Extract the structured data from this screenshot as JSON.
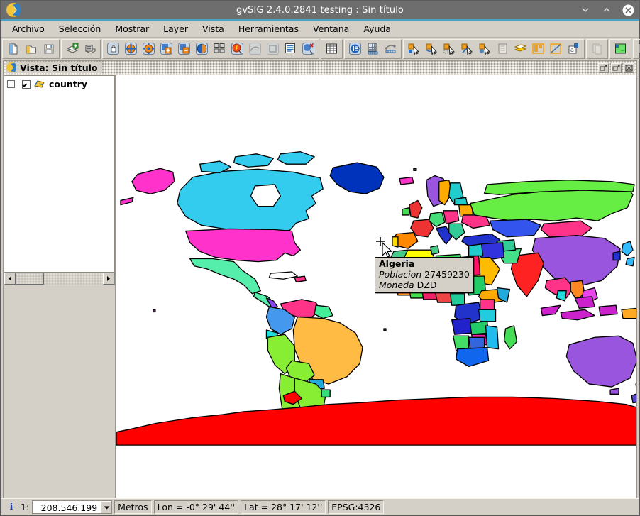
{
  "window": {
    "title": "gvSIG 2.4.0.2841 testing : Sin título",
    "logo_icon": "gvsig-logo-icon",
    "controls": [
      {
        "name": "minimize-button",
        "icon": "chevron-down-icon"
      },
      {
        "name": "maximize-button",
        "icon": "chevron-up-icon"
      },
      {
        "name": "close-button",
        "icon": "close-circle-icon"
      }
    ]
  },
  "menubar": {
    "items": [
      {
        "label": "Archivo",
        "mnemonic": "A"
      },
      {
        "label": "Selección",
        "mnemonic": "S"
      },
      {
        "label": "Mostrar",
        "mnemonic": "M"
      },
      {
        "label": "Layer",
        "mnemonic": "L"
      },
      {
        "label": "Vista",
        "mnemonic": "V"
      },
      {
        "label": "Herramientas",
        "mnemonic": "H"
      },
      {
        "label": "Ventana",
        "mnemonic": "V"
      },
      {
        "label": "Ayuda",
        "mnemonic": "A"
      }
    ]
  },
  "toolbar": {
    "groups": [
      {
        "name": "file-group",
        "buttons": [
          {
            "name": "new-project-button",
            "icon": "new-document-icon",
            "state": "enabled"
          },
          {
            "name": "open-project-button",
            "icon": "open-folder-icon",
            "state": "enabled"
          },
          {
            "name": "save-project-button",
            "icon": "save-disk-icon",
            "state": "enabled"
          }
        ]
      },
      {
        "name": "layer-group",
        "buttons": [
          {
            "name": "add-layer-button",
            "icon": "add-layer-icon",
            "state": "enabled"
          },
          {
            "name": "layer-properties-button",
            "icon": "layer-table-icon",
            "state": "enabled"
          }
        ]
      },
      {
        "name": "navigation-group",
        "buttons": [
          {
            "name": "pan-button",
            "icon": "hand-pan-icon",
            "state": "enabled"
          },
          {
            "name": "zoom-in-rect-button",
            "icon": "zoom-in-rect-icon",
            "state": "enabled"
          },
          {
            "name": "zoom-out-rect-button",
            "icon": "zoom-out-rect-icon",
            "state": "enabled"
          },
          {
            "name": "zoom-in-button",
            "icon": "zoom-plus-icon",
            "state": "enabled"
          },
          {
            "name": "zoom-out-button",
            "icon": "zoom-minus-icon",
            "state": "enabled"
          },
          {
            "name": "zoom-full-extent-button",
            "icon": "globe-extent-icon",
            "state": "enabled"
          },
          {
            "name": "zoom-to-layer-button",
            "icon": "zoom-layer-icon",
            "state": "enabled"
          },
          {
            "name": "info-tool-button",
            "icon": "info-arrow-icon",
            "state": "enabled"
          },
          {
            "name": "measure-distance-button",
            "icon": "measure-line-icon",
            "state": "disabled"
          },
          {
            "name": "measure-area-button",
            "icon": "measure-area-icon",
            "state": "disabled"
          },
          {
            "name": "view-center-button",
            "icon": "center-view-icon",
            "state": "enabled"
          },
          {
            "name": "zoom-previous-button",
            "icon": "zoom-prev-icon",
            "state": "enabled"
          }
        ]
      },
      {
        "name": "table-group",
        "buttons": [
          {
            "name": "attribute-table-button",
            "icon": "table-grid-icon",
            "state": "enabled"
          }
        ]
      },
      {
        "name": "annotation-group",
        "buttons": [
          {
            "name": "layer-info-button",
            "icon": "layer-info-icon",
            "state": "enabled"
          },
          {
            "name": "grid-settings-button",
            "icon": "grid-ruler-icon",
            "state": "enabled"
          },
          {
            "name": "profile-tool-button",
            "icon": "profile-curve-icon",
            "state": "enabled"
          }
        ]
      },
      {
        "name": "selection-group",
        "buttons": [
          {
            "name": "select-by-point-button",
            "icon": "select-point-icon",
            "state": "enabled"
          },
          {
            "name": "select-by-rect-button",
            "icon": "select-rect-icon",
            "state": "enabled"
          },
          {
            "name": "select-by-polygon-button",
            "icon": "select-polygon-icon",
            "state": "enabled"
          },
          {
            "name": "select-by-circle-button",
            "icon": "select-circle-icon",
            "state": "enabled"
          },
          {
            "name": "select-by-buffer-button",
            "icon": "select-buffer-icon",
            "state": "enabled"
          },
          {
            "name": "select-all-button",
            "icon": "select-all-icon",
            "state": "enabled"
          },
          {
            "name": "invert-selection-button",
            "icon": "invert-selection-icon",
            "state": "enabled"
          },
          {
            "name": "clear-selection-button",
            "icon": "clear-selection-icon",
            "state": "enabled"
          },
          {
            "name": "selection-by-layer-button",
            "icon": "selection-layer-icon",
            "state": "enabled"
          },
          {
            "name": "selection-by-attribute-button",
            "icon": "selection-attribute-icon",
            "state": "enabled"
          }
        ]
      },
      {
        "name": "geoprocess-group",
        "buttons": [
          {
            "name": "copy-features-button",
            "icon": "copy-features-icon",
            "state": "disabled"
          }
        ]
      },
      {
        "name": "raster-group",
        "buttons": [
          {
            "name": "raster-properties-button",
            "icon": "raster-image-icon",
            "state": "enabled"
          }
        ]
      },
      {
        "name": "catalog-group",
        "buttons": [
          {
            "name": "legend-editor-button",
            "icon": "legend-edit-icon",
            "state": "enabled"
          },
          {
            "name": "geoprocessing-button",
            "icon": "gear-star-icon",
            "state": "enabled"
          },
          {
            "name": "information-tool-button",
            "icon": "info-pencil-icon",
            "state": "selected"
          }
        ]
      }
    ]
  },
  "view_window": {
    "title": "Vista: Sin título",
    "icon": "gvsig-mini-logo-icon",
    "controls": [
      {
        "name": "restore-window-button",
        "icon": "restore-icon"
      },
      {
        "name": "maximize-window-button",
        "icon": "maximize-icon"
      },
      {
        "name": "close-window-button",
        "icon": "close-x-icon"
      }
    ]
  },
  "toc": {
    "layers": [
      {
        "name": "country",
        "visible": true,
        "expanded": false,
        "icon": "polygon-layer-icon"
      }
    ],
    "scrollbar": {
      "left_arrow": "◀",
      "right_arrow": "▶"
    }
  },
  "tooltip": {
    "title": "Algeria",
    "fields": [
      {
        "label": "Poblacion",
        "value": "27459230"
      },
      {
        "label": "Moneda",
        "value": "DZD"
      }
    ]
  },
  "statusbar": {
    "info_icon": "info-i-icon",
    "scale_prefix": "1:",
    "scale_value": "208.546.199",
    "units": "Metros",
    "longitude": "Lon = -0° 29' 44''",
    "latitude": "Lat = 28° 17' 12''",
    "projection": "EPSG:4326"
  },
  "colors": {
    "titlebar_bg": "#6e6e6e",
    "accent_line": "#4aa3c7",
    "chrome_bg": "#d4d0c8",
    "map_bg": "#ffffff",
    "country_highlight": "#ffff00",
    "antarctica": "#ff0000",
    "russia": "#66ee44",
    "canada": "#33ccee",
    "usa": "#ff33cc",
    "china": "#9955dd",
    "brazil": "#ffbb44",
    "india": "#ff2222",
    "australia": "#9955dd",
    "greenland": "#0033bb"
  },
  "map": {
    "layer": "country",
    "projection": "EPSG:4326",
    "countries": [
      {
        "name": "Greenland",
        "color": "#0033bb"
      },
      {
        "name": "Canada",
        "color": "#33ccee"
      },
      {
        "name": "United States",
        "color": "#ff33cc"
      },
      {
        "name": "Alaska",
        "color": "#ff33cc"
      },
      {
        "name": "Mexico",
        "color": "#55eeaa"
      },
      {
        "name": "Brazil",
        "color": "#ffbb44"
      },
      {
        "name": "Argentina",
        "color": "#88ee33"
      },
      {
        "name": "Peru",
        "color": "#88ee33"
      },
      {
        "name": "Colombia",
        "color": "#4499ee"
      },
      {
        "name": "Venezuela",
        "color": "#ff3388"
      },
      {
        "name": "Russia",
        "color": "#66ee44"
      },
      {
        "name": "China",
        "color": "#9955dd"
      },
      {
        "name": "India",
        "color": "#ff2222"
      },
      {
        "name": "Mongolia",
        "color": "#ff3388"
      },
      {
        "name": "Kazakhstan",
        "color": "#3355ee"
      },
      {
        "name": "Algeria",
        "color": "#ffff00"
      },
      {
        "name": "Libya",
        "color": "#33dd55"
      },
      {
        "name": "Egypt",
        "color": "#ff1166"
      },
      {
        "name": "Saudi Arabia",
        "color": "#ffbb00"
      },
      {
        "name": "Australia",
        "color": "#9955dd"
      },
      {
        "name": "Antarctica",
        "color": "#ff0000"
      },
      {
        "name": "France",
        "color": "#ee3333"
      },
      {
        "name": "Spain",
        "color": "#ff8800"
      },
      {
        "name": "Sweden",
        "color": "#ffaa00"
      },
      {
        "name": "Ukraine",
        "color": "#ff3388"
      },
      {
        "name": "Turkey",
        "color": "#2233cc"
      },
      {
        "name": "Iran",
        "color": "#3333dd"
      },
      {
        "name": "Indonesia",
        "color": "#cc22cc"
      },
      {
        "name": "Madagascar",
        "color": "#44dd55"
      },
      {
        "name": "South Africa",
        "color": "#1166ee"
      },
      {
        "name": "Angola",
        "color": "#2222cc"
      },
      {
        "name": "Nigeria",
        "color": "#ee4444"
      },
      {
        "name": "Sudan",
        "color": "#22cc66"
      },
      {
        "name": "New Zealand",
        "color": "#5544cc"
      },
      {
        "name": "Japan",
        "color": "#33bbff"
      },
      {
        "name": "Papua New Guinea",
        "color": "#ffaa22"
      }
    ]
  }
}
